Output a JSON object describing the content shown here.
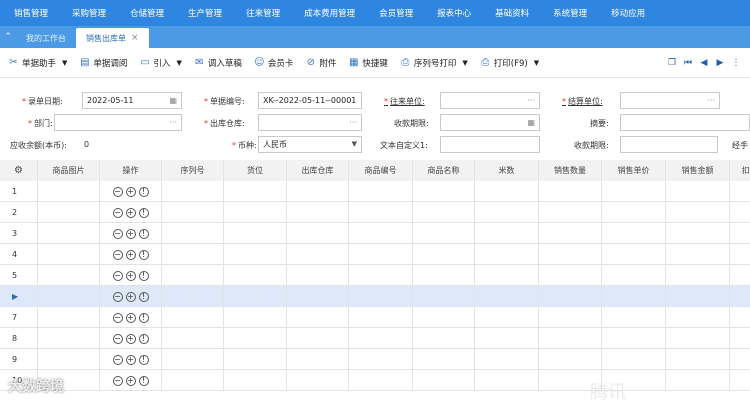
{
  "topmenu": [
    "销售管理",
    "采购管理",
    "仓储管理",
    "生产管理",
    "往来管理",
    "成本费用管理",
    "会员管理",
    "报表中心",
    "基础资料",
    "系统管理",
    "移动应用"
  ],
  "tabs": {
    "back_icon": "chevron-up-icon",
    "items": [
      {
        "label": "我的工作台",
        "active": false
      },
      {
        "label": "销售出库单",
        "active": true
      }
    ],
    "close_glyph": "×"
  },
  "toolbar": {
    "buttons": [
      {
        "label": "单据助手",
        "icon": "tool-icon",
        "dropdown": true
      },
      {
        "label": "单据调阅",
        "icon": "document-icon",
        "dropdown": false
      },
      {
        "label": "引入",
        "icon": "import-icon",
        "dropdown": true
      },
      {
        "label": "调入草稿",
        "icon": "draft-icon",
        "dropdown": false
      },
      {
        "label": "会员卡",
        "icon": "member-card-icon",
        "dropdown": false
      },
      {
        "label": "附件",
        "icon": "attachment-icon",
        "dropdown": false
      },
      {
        "label": "快捷键",
        "icon": "keyboard-icon",
        "dropdown": false
      },
      {
        "label": "序列号打印",
        "icon": "printer-icon",
        "dropdown": true
      },
      {
        "label": "打印(F9)",
        "icon": "printer-icon",
        "dropdown": true
      }
    ]
  },
  "form": {
    "date_label": "录单日期:",
    "date_value": "2022-05-11",
    "docno_label": "单据编号:",
    "docno_value": "XK--2022-05-11--00001",
    "partner_label": "往来单位:",
    "settle_label": "结算单位:",
    "dept_label": "部门:",
    "warehouse_label": "出库仓库:",
    "due_label": "收款期限:",
    "summary_label": "摘要:",
    "receivable_label": "应收余额(本币):",
    "receivable_value": "0",
    "currency_label": "币种:",
    "currency_value": "人民币",
    "custom1_label": "文本自定义1:",
    "due2_label": "收款期限:",
    "handler_label": "经手",
    "ellipsis": "···"
  },
  "grid": {
    "headers": [
      "",
      "商品图片",
      "操作",
      "序列号",
      "货位",
      "出库仓库",
      "商品编号",
      "商品名称",
      "米数",
      "销售数量",
      "销售单价",
      "销售金额",
      "扣率"
    ],
    "rows": [
      "1",
      "2",
      "3",
      "4",
      "5",
      "▶",
      "7",
      "8",
      "9",
      "10"
    ],
    "selected_row_index": 5,
    "settings_icon": "gear-icon"
  },
  "watermark": {
    "left": "大数跨境",
    "right": "腾讯"
  }
}
